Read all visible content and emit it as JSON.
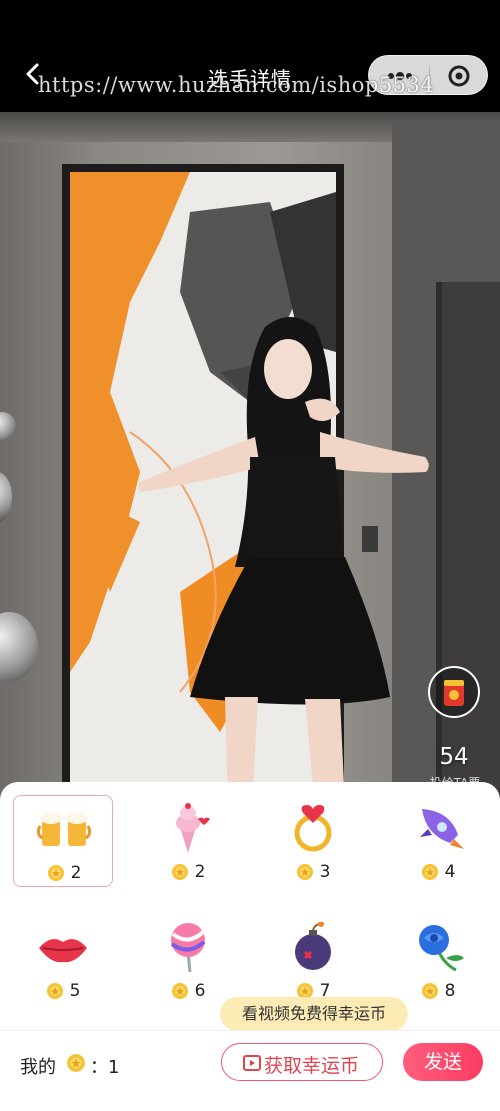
{
  "header": {
    "title": "选手详情",
    "watermark": "https://www.huzhan.com/ishop5534"
  },
  "video": {
    "stat_value": "54",
    "stat_caption": "投给TA票"
  },
  "gifts": [
    {
      "icon": "beer-mugs-icon",
      "price": "2",
      "selected": true
    },
    {
      "icon": "ice-cream-cone-icon",
      "price": "2",
      "selected": false
    },
    {
      "icon": "heart-ring-icon",
      "price": "3",
      "selected": false
    },
    {
      "icon": "rocket-icon",
      "price": "4",
      "selected": false
    },
    {
      "icon": "lips-icon",
      "price": "5",
      "selected": false
    },
    {
      "icon": "lollipop-icon",
      "price": "6",
      "selected": false
    },
    {
      "icon": "bomb-icon",
      "price": "7",
      "selected": false
    },
    {
      "icon": "blue-rose-icon",
      "price": "8",
      "selected": false
    }
  ],
  "tooltip": "看视频免费得幸运币",
  "footer": {
    "balance_label": "我的",
    "balance_value": "：1",
    "earn_label": "获取幸运币",
    "send_label": "发送"
  },
  "colors": {
    "accent": "#fb3c62",
    "tooltip_bg": "#fdebb6",
    "selected_border": "#f1a9a9",
    "coin": "#f7c233"
  }
}
